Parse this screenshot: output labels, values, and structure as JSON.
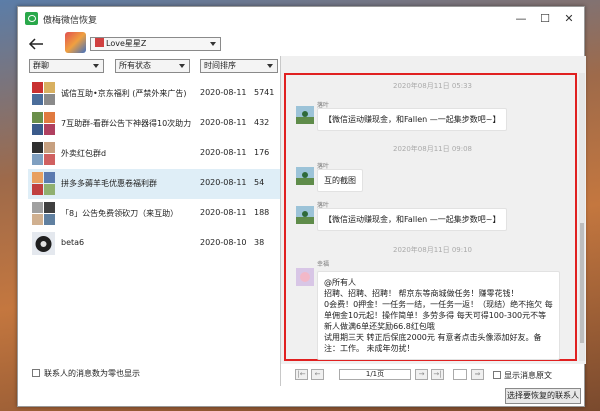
{
  "window": {
    "title": "傲梅微信恢复"
  },
  "window_controls": {
    "minimize": "—",
    "maximize": "☐",
    "close": "✕"
  },
  "account": {
    "selected": "Love星星Z"
  },
  "filters": {
    "type": "群聊",
    "status": "所有状态",
    "sort": "时间排序"
  },
  "conversations": [
    {
      "name": "诚信互助•京东福利 (严禁外来广告)",
      "date": "2020-08-11",
      "count": "5741"
    },
    {
      "name": "7互助群-看群公告下神器得10次助力",
      "date": "2020-08-11",
      "count": "432"
    },
    {
      "name": "外卖红包群d",
      "date": "2020-08-11",
      "count": "176"
    },
    {
      "name": "拼多多薅羊毛优惠卷福利群",
      "date": "2020-08-11",
      "count": "54"
    },
    {
      "name": "「8」公告免费领砍刀（来互助）",
      "date": "2020-08-11",
      "count": "188"
    },
    {
      "name": "beta6",
      "date": "2020-08-10",
      "count": "38"
    }
  ],
  "left_footer": {
    "zero_count_label": "联系人的消息数为零也显示"
  },
  "messages": [
    {
      "timestamp": "2020年08月11日 05:33",
      "sender": "落叶",
      "text": "【微信运动赚现金，和Fallen  —一起集步数吧~】"
    },
    {
      "timestamp": "2020年08月11日 09:08",
      "sender": "落叶",
      "text": "互的截图"
    },
    {
      "timestamp": "",
      "sender": "落叶",
      "text": "【微信运动赚现金，和Fallen  —一起集步数吧~】"
    },
    {
      "timestamp": "2020年08月11日 09:10",
      "sender": "幸福",
      "text": "@所有人\n  招聘、招聘、招聘！ 帮京东等商城做任务！赚零花钱！\n  0会费！0押金！一任务一结，一任务一返！（现结）绝不拖欠 每单佣金10元起！操作简单！多劳多得 每天可得100-300元不等   新人做满6单还奖励66.8红包哦\n试用期三天 转正后保底2000元 有意者点击头像添加好友。备注：工作。     未成年勿扰！"
    }
  ],
  "pager": {
    "first": "|←",
    "prev": "←",
    "page": "1/1页",
    "next": "→",
    "last": "→|",
    "jump": "⇒",
    "show_original": "显示消息原文"
  },
  "actions": {
    "export": "选择要恢复的联系人"
  }
}
